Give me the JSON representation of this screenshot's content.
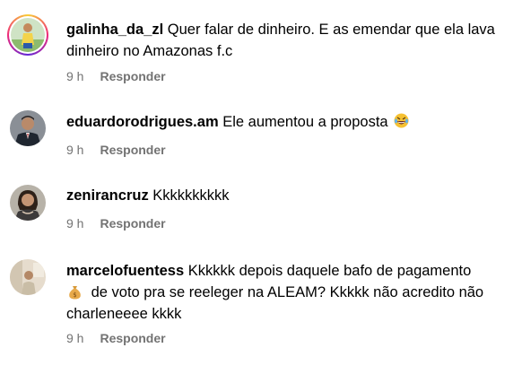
{
  "comments": [
    {
      "username": "galinha_da_zl",
      "text": "Quer falar de dinheiro. E as emendar que ela lava dinheiro no Amazonas f.c",
      "time": "9 h",
      "reply": "Responder",
      "avatar_icon": "soccer-player-avatar"
    },
    {
      "username": "eduardorodrigues.am",
      "text": "Ele aumentou a proposta",
      "emoji": "rolling-laughing-emoji",
      "time": "9 h",
      "reply": "Responder",
      "avatar_icon": "man-in-suit-avatar"
    },
    {
      "username": "zenirancruz",
      "text": "Kkkkkkkkkk",
      "time": "9 h",
      "reply": "Responder",
      "avatar_icon": "woman-avatar"
    },
    {
      "username": "marcelofuentess",
      "text_line1": "Kkkkkk depois daquele bafo de pagamento",
      "text_line2": "de voto pra se reeleger na ALEAM? Kkkkk não acredito não",
      "text_line3": "charleneeee kkkk",
      "emoji": "money-bag-emoji",
      "time": "9 h",
      "reply": "Responder",
      "avatar_icon": "person-indoor-avatar"
    }
  ],
  "colors": {
    "meta": "#737373",
    "text": "#000000",
    "story_ring_start": "#f9ce34",
    "story_ring_mid": "#ee2a7b"
  }
}
